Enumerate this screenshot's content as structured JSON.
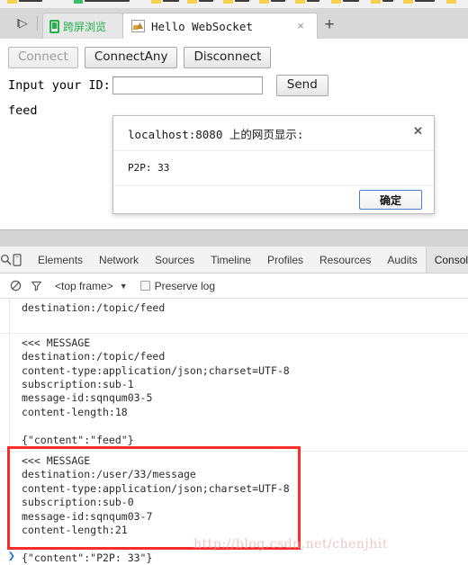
{
  "browser": {
    "bookmarks_bar": {
      "visible_partial": true,
      "items": [
        "",
        "",
        "",
        "",
        "",
        "",
        "",
        "",
        "",
        "",
        "",
        ""
      ]
    },
    "nav_arrow_icon": "expand-arrow-icon",
    "new_tab_label": "+",
    "tabs": [
      {
        "title": "跨屏浏览",
        "favicon": "phone-icon",
        "active": false,
        "closable": false
      },
      {
        "title": "Hello WebSocket",
        "favicon": "image-icon",
        "active": true,
        "closable": true,
        "close_label": "×"
      }
    ]
  },
  "page": {
    "buttons": [
      {
        "label": "Connect",
        "disabled": true
      },
      {
        "label": "ConnectAny",
        "disabled": false
      },
      {
        "label": "Disconnect",
        "disabled": false
      }
    ],
    "input_label": "Input your ID:",
    "input_value": "",
    "input_placeholder": "",
    "send_label": "Send",
    "output_text": "feed"
  },
  "dialog": {
    "title": "localhost:8080 上的网页显示:",
    "message": "P2P: 33",
    "ok_label": "确定",
    "close_label": "✕",
    "accent_color": "#4a7fd4"
  },
  "devtools": {
    "left_icons": [
      "search-icon",
      "device-toggle-icon"
    ],
    "tabs": [
      {
        "label": "Elements",
        "selected": false
      },
      {
        "label": "Network",
        "selected": false
      },
      {
        "label": "Sources",
        "selected": false
      },
      {
        "label": "Timeline",
        "selected": false
      },
      {
        "label": "Profiles",
        "selected": false
      },
      {
        "label": "Resources",
        "selected": false
      },
      {
        "label": "Audits",
        "selected": false
      },
      {
        "label": "Console",
        "selected": true
      }
    ],
    "toolbar": {
      "clear_icon": "clear-console-icon",
      "filter_icon": "filter-icon",
      "frame_selector": "<top frame>",
      "frame_caret": "▼",
      "preserve_log_label": "Preserve log",
      "preserve_log_checked": false
    },
    "console_entries": [
      {
        "lines": [
          "destination:/topic/feed",
          ""
        ],
        "highlighted": false
      },
      {
        "lines": [
          "<<< MESSAGE",
          "destination:/topic/feed",
          "content-type:application/json;charset=UTF-8",
          "subscription:sub-1",
          "message-id:sqnqum03-5",
          "content-length:18",
          "",
          "{\"content\":\"feed\"}"
        ],
        "highlighted": false
      },
      {
        "lines": [
          "<<< MESSAGE",
          "destination:/user/33/message",
          "content-type:application/json;charset=UTF-8",
          "subscription:sub-0",
          "message-id:sqnqum03-7",
          "content-length:21",
          "",
          "{\"content\":\"P2P: 33\"}"
        ],
        "highlighted": true
      }
    ],
    "prompt_symbol": "❯"
  },
  "annotations": {
    "highlight_color": "#fb2c2c",
    "watermark": "http://blog.csdn.net/chenjhit"
  }
}
